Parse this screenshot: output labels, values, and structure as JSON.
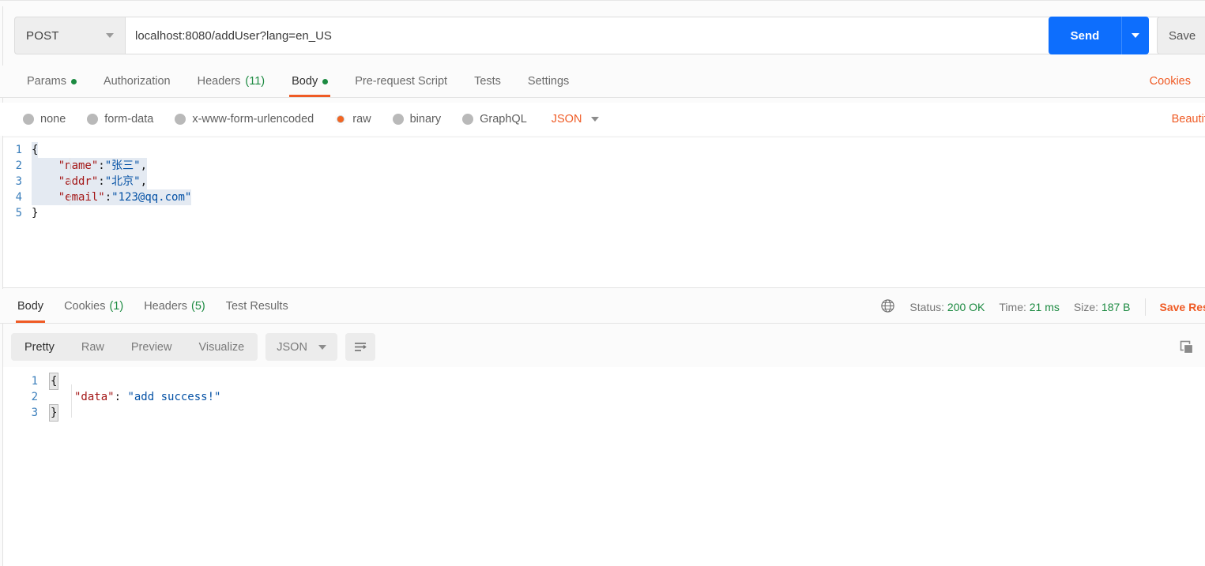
{
  "request": {
    "method": "POST",
    "url": "localhost:8080/addUser?lang=en_US",
    "send_label": "Send",
    "save_label": "Save",
    "tabs": [
      {
        "label": "Params",
        "badge": "",
        "dot": true,
        "active": false
      },
      {
        "label": "Authorization",
        "badge": "",
        "dot": false,
        "active": false
      },
      {
        "label": "Headers",
        "badge": "(11)",
        "dot": false,
        "active": false
      },
      {
        "label": "Body",
        "badge": "",
        "dot": true,
        "active": true
      },
      {
        "label": "Pre-request Script",
        "badge": "",
        "dot": false,
        "active": false
      },
      {
        "label": "Tests",
        "badge": "",
        "dot": false,
        "active": false
      },
      {
        "label": "Settings",
        "badge": "",
        "dot": false,
        "active": false
      }
    ],
    "cookies_link": "Cookies",
    "body_types": [
      {
        "label": "none",
        "selected": false
      },
      {
        "label": "form-data",
        "selected": false
      },
      {
        "label": "x-www-form-urlencoded",
        "selected": false
      },
      {
        "label": "raw",
        "selected": true
      },
      {
        "label": "binary",
        "selected": false
      },
      {
        "label": "GraphQL",
        "selected": false
      }
    ],
    "raw_format": "JSON",
    "beautify_link": "Beautify",
    "body_lines": [
      {
        "num": "1",
        "segments": [
          {
            "text": "{",
            "cls": "p"
          }
        ]
      },
      {
        "num": "2",
        "segments": [
          {
            "text": "    ",
            "cls": "p"
          },
          {
            "text": "\"name\"",
            "cls": "k"
          },
          {
            "text": ":",
            "cls": "p"
          },
          {
            "text": "\"张三\"",
            "cls": "v"
          },
          {
            "text": ",",
            "cls": "p"
          }
        ]
      },
      {
        "num": "3",
        "segments": [
          {
            "text": "    ",
            "cls": "p"
          },
          {
            "text": "\"addr\"",
            "cls": "k"
          },
          {
            "text": ":",
            "cls": "p"
          },
          {
            "text": "\"北京\"",
            "cls": "v"
          },
          {
            "text": ",",
            "cls": "p"
          }
        ]
      },
      {
        "num": "4",
        "segments": [
          {
            "text": "    ",
            "cls": "p"
          },
          {
            "text": "\"email\"",
            "cls": "k"
          },
          {
            "text": ":",
            "cls": "p"
          },
          {
            "text": "\"123@qq.com\"",
            "cls": "v"
          }
        ]
      },
      {
        "num": "5",
        "segments": [
          {
            "text": "}",
            "cls": "p"
          }
        ]
      }
    ]
  },
  "response": {
    "tabs": [
      {
        "label": "Body",
        "badge": "",
        "active": true
      },
      {
        "label": "Cookies",
        "badge": "(1)",
        "active": false
      },
      {
        "label": "Headers",
        "badge": "(5)",
        "active": false
      },
      {
        "label": "Test Results",
        "badge": "",
        "active": false
      }
    ],
    "status_label": "Status:",
    "status_value": "200 OK",
    "time_label": "Time:",
    "time_value": "21 ms",
    "size_label": "Size:",
    "size_value": "187 B",
    "save_response": "Save Response",
    "view_modes": [
      {
        "label": "Pretty",
        "active": true
      },
      {
        "label": "Raw",
        "active": false
      },
      {
        "label": "Preview",
        "active": false
      },
      {
        "label": "Visualize",
        "active": false
      }
    ],
    "format": "JSON",
    "body_lines": [
      {
        "num": "1",
        "brace": "{"
      },
      {
        "num": "2",
        "key": "\"data\"",
        "colon": ": ",
        "value": "\"add success!\""
      },
      {
        "num": "3",
        "brace": "}"
      }
    ]
  },
  "colors": {
    "accent_orange": "#ef5b25",
    "send_blue": "#0d6efd",
    "status_green": "#1c8a41",
    "json_key": "#a31515",
    "json_value": "#0451a5"
  }
}
